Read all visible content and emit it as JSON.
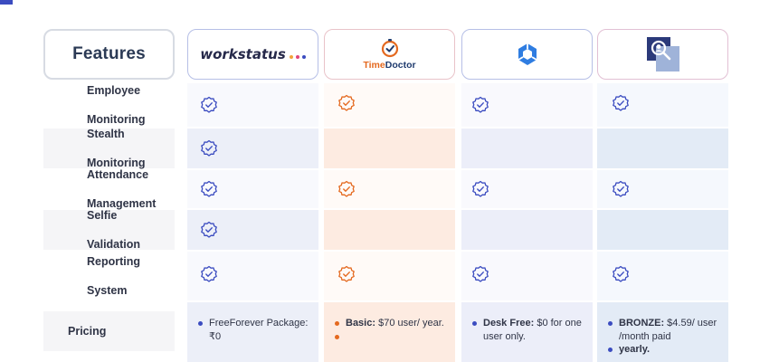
{
  "table": {
    "features_header": "Features",
    "columns": [
      {
        "id": "workstatus",
        "logo_text": "workstatus",
        "dot_colors": [
          "#f2a33a",
          "#e0457b",
          "#3b4cc0"
        ]
      },
      {
        "id": "timedoctor",
        "logo_text_time": "Time",
        "logo_text_doctor": "Doctor",
        "accent": "#e4691f"
      },
      {
        "id": "competitor3",
        "logo_icon": "blue-hexagon-logo-icon",
        "accent": "#2f7de1"
      },
      {
        "id": "competitor4",
        "logo_icon": "magnifier-person-logo-icon",
        "accent": "#2b3a7a"
      }
    ],
    "rows": [
      {
        "label_line1": "Employee",
        "label_line2": "Monitoring",
        "checks": [
          true,
          true,
          true,
          true
        ]
      },
      {
        "label_line1": "Stealth",
        "label_line2": "Monitoring",
        "checks": [
          true,
          false,
          false,
          false
        ]
      },
      {
        "label_line1": "Attendance",
        "label_line2": "Management",
        "checks": [
          true,
          true,
          true,
          true
        ]
      },
      {
        "label_line1": "Selfie",
        "label_line2": "Validation",
        "checks": [
          true,
          false,
          false,
          false
        ]
      },
      {
        "label_line1": "Reporting",
        "label_line2": "System",
        "checks": [
          true,
          true,
          true,
          true
        ]
      }
    ],
    "pricing": {
      "label": "Pricing",
      "workstatus": {
        "text": "FreeForever Package: ₹0"
      },
      "timedoctor": {
        "bold": "Basic:",
        "text": " $70 user/ year."
      },
      "competitor3": {
        "bold": "Desk Free:",
        "text": " $0 for one user only."
      },
      "competitor4": [
        {
          "bold": "BRONZE:",
          "text": " $4.59/ user /month paid"
        },
        {
          "text": "yearly."
        }
      ]
    },
    "colors": {
      "check_blue": "#3b4cc0",
      "check_orange": "#e4691f",
      "bullet_blue": "#3b4cc0",
      "bullet_orange": "#e4691f"
    }
  }
}
